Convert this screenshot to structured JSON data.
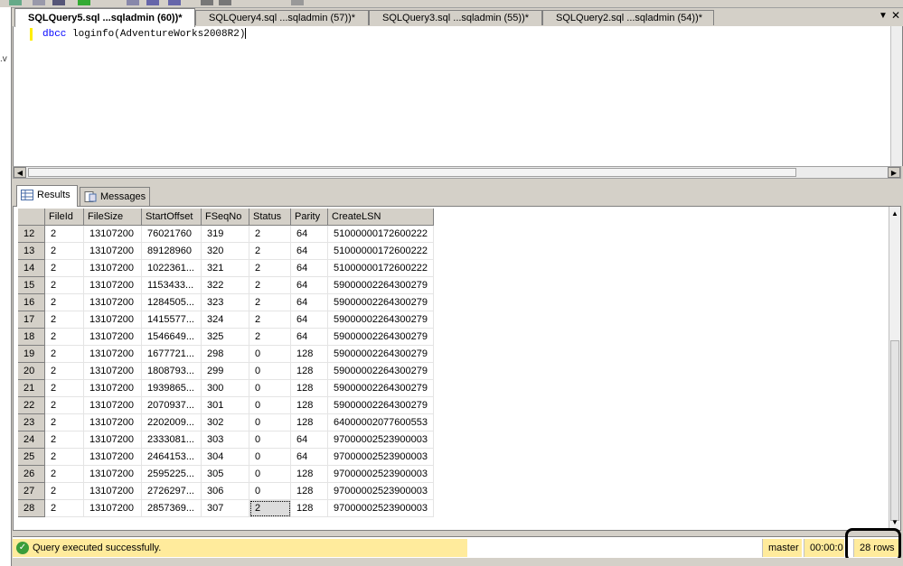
{
  "tabs": [
    {
      "label": "SQLQuery5.sql ...sqladmin (60))*",
      "active": true
    },
    {
      "label": "SQLQuery4.sql ...sqladmin (57))*",
      "active": false
    },
    {
      "label": "SQLQuery3.sql ...sqladmin (55))*",
      "active": false
    },
    {
      "label": "SQLQuery2.sql ...sqladmin (54))*",
      "active": false
    }
  ],
  "tab_menu_icon": "dropdown-arrow-icon",
  "tab_close_icon": "close-icon",
  "editor": {
    "keyword": "dbcc",
    "code_rest": " loginfo(AdventureWorks2008R2)"
  },
  "result_tabs": [
    {
      "label": "Results",
      "icon": "grid-icon",
      "active": true
    },
    {
      "label": "Messages",
      "icon": "messages-icon",
      "active": false
    }
  ],
  "grid": {
    "columns": [
      "FileId",
      "FileSize",
      "StartOffset",
      "FSeqNo",
      "Status",
      "Parity",
      "CreateLSN"
    ],
    "rows": [
      [
        "12",
        "2",
        "13107200",
        "76021760",
        "319",
        "2",
        "64",
        "51000000172600222"
      ],
      [
        "13",
        "2",
        "13107200",
        "89128960",
        "320",
        "2",
        "64",
        "51000000172600222"
      ],
      [
        "14",
        "2",
        "13107200",
        "1022361...",
        "321",
        "2",
        "64",
        "51000000172600222"
      ],
      [
        "15",
        "2",
        "13107200",
        "1153433...",
        "322",
        "2",
        "64",
        "59000002264300279"
      ],
      [
        "16",
        "2",
        "13107200",
        "1284505...",
        "323",
        "2",
        "64",
        "59000002264300279"
      ],
      [
        "17",
        "2",
        "13107200",
        "1415577...",
        "324",
        "2",
        "64",
        "59000002264300279"
      ],
      [
        "18",
        "2",
        "13107200",
        "1546649...",
        "325",
        "2",
        "64",
        "59000002264300279"
      ],
      [
        "19",
        "2",
        "13107200",
        "1677721...",
        "298",
        "0",
        "128",
        "59000002264300279"
      ],
      [
        "20",
        "2",
        "13107200",
        "1808793...",
        "299",
        "0",
        "128",
        "59000002264300279"
      ],
      [
        "21",
        "2",
        "13107200",
        "1939865...",
        "300",
        "0",
        "128",
        "59000002264300279"
      ],
      [
        "22",
        "2",
        "13107200",
        "2070937...",
        "301",
        "0",
        "128",
        "59000002264300279"
      ],
      [
        "23",
        "2",
        "13107200",
        "2202009...",
        "302",
        "0",
        "128",
        "64000002077600553"
      ],
      [
        "24",
        "2",
        "13107200",
        "2333081...",
        "303",
        "0",
        "64",
        "97000002523900003"
      ],
      [
        "25",
        "2",
        "13107200",
        "2464153...",
        "304",
        "0",
        "64",
        "97000002523900003"
      ],
      [
        "26",
        "2",
        "13107200",
        "2595225...",
        "305",
        "0",
        "128",
        "97000002523900003"
      ],
      [
        "27",
        "2",
        "13107200",
        "2726297...",
        "306",
        "0",
        "128",
        "97000002523900003"
      ],
      [
        "28",
        "2",
        "13107200",
        "2857369...",
        "307",
        "2",
        "128",
        "97000002523900003"
      ]
    ],
    "selected_cell": {
      "row_label": "28",
      "column": "Status"
    }
  },
  "status": {
    "message": "Query executed successfully.",
    "icon": "check-circle-icon",
    "database": "master",
    "elapsed": "00:00:0",
    "rows": "28 rows"
  },
  "left_gutter_text": ".v"
}
